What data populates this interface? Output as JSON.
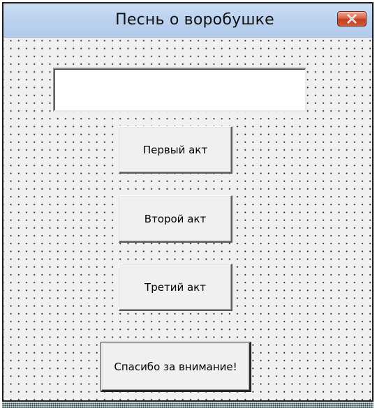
{
  "window": {
    "title": "Песнь  о воробушке",
    "close_icon": "close-x-icon"
  },
  "form": {
    "textbox_value": "",
    "buttons": {
      "act1": "Первый акт",
      "act2": "Второй акт",
      "act3": "Третий акт",
      "thanks": "Спасибо за внимание!"
    }
  },
  "colors": {
    "titlebar": "#bcd2ef",
    "close_button": "#c23c20",
    "form_background": "#f0f0f0",
    "grid_dots": "#2a2a2a"
  }
}
